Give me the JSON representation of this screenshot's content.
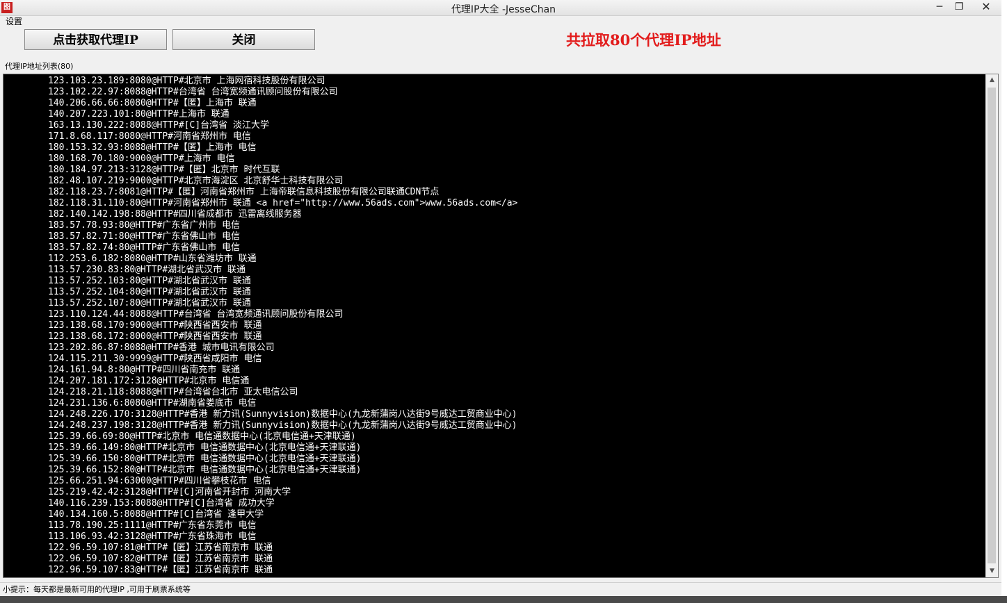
{
  "window": {
    "title": "代理IP大全 -JesseChan",
    "icon_text": "图",
    "min_glyph": "─",
    "max_glyph": "❐",
    "close_glyph": "✕"
  },
  "menu": {
    "settings_label": "设置"
  },
  "toolbar": {
    "fetch_label": "点击获取代理IP",
    "close_label": "关闭",
    "count_text": "共拉取80个代理IP地址",
    "accent_color": "#e21b1b"
  },
  "list_group_label": "代理IP地址列表(80)",
  "proxy_list": [
    "123.103.23.189:8080@HTTP#北京市 上海网宿科技股份有限公司",
    "123.102.22.97:8088@HTTP#台湾省 台湾宽频通讯顾问股份有限公司",
    "140.206.66.66:8080@HTTP#【匿】上海市 联通",
    "140.207.223.101:80@HTTP#上海市 联通",
    "163.13.130.222:8088@HTTP#[C]台湾省 淡江大学",
    "171.8.68.117:8080@HTTP#河南省郑州市 电信",
    "180.153.32.93:8088@HTTP#【匿】上海市 电信",
    "180.168.70.180:9000@HTTP#上海市 电信",
    "180.184.97.213:3128@HTTP#【匿】北京市 时代互联",
    "182.48.107.219:9000@HTTP#北京市海淀区 北京舒华士科技有限公司",
    "182.118.23.7:8081@HTTP#【匿】河南省郑州市 上海帝联信息科技股份有限公司联通CDN节点",
    "182.118.31.110:80@HTTP#河南省郑州市 联通 <a href=\"http://www.56ads.com\">www.56ads.com</a>",
    "182.140.142.198:88@HTTP#四川省成都市 迅雷离线服务器",
    "183.57.78.93:80@HTTP#广东省广州市 电信",
    "183.57.82.71:80@HTTP#广东省佛山市 电信",
    "183.57.82.74:80@HTTP#广东省佛山市 电信",
    "112.253.6.182:8080@HTTP#山东省潍坊市 联通",
    "113.57.230.83:80@HTTP#湖北省武汉市 联通",
    "113.57.252.103:80@HTTP#湖北省武汉市 联通",
    "113.57.252.104:80@HTTP#湖北省武汉市 联通",
    "113.57.252.107:80@HTTP#湖北省武汉市 联通",
    "123.110.124.44:8088@HTTP#台湾省 台湾宽频通讯顾问股份有限公司",
    "123.138.68.170:9000@HTTP#陕西省西安市 联通",
    "123.138.68.172:8000@HTTP#陕西省西安市 联通",
    "123.202.86.87:8088@HTTP#香港 城市电讯有限公司",
    "124.115.211.30:9999@HTTP#陕西省咸阳市 电信",
    "124.161.94.8:80@HTTP#四川省南充市 联通",
    "124.207.181.172:3128@HTTP#北京市 电信通",
    "124.218.21.118:8088@HTTP#台湾省台北市 亚太电信公司",
    "124.231.136.6:8080@HTTP#湖南省娄底市 电信",
    "124.248.226.170:3128@HTTP#香港 新力讯(Sunnyvision)数据中心(九龙新蒲岗八达街9号威达工贸商业中心)",
    "124.248.237.198:3128@HTTP#香港 新力讯(Sunnyvision)数据中心(九龙新蒲岗八达街9号威达工贸商业中心)",
    "125.39.66.69:80@HTTP#北京市 电信通数据中心(北京电信通+天津联通)",
    "125.39.66.149:80@HTTP#北京市 电信通数据中心(北京电信通+天津联通)",
    "125.39.66.150:80@HTTP#北京市 电信通数据中心(北京电信通+天津联通)",
    "125.39.66.152:80@HTTP#北京市 电信通数据中心(北京电信通+天津联通)",
    "125.66.251.94:63000@HTTP#四川省攀枝花市 电信",
    "125.219.42.42:3128@HTTP#[C]河南省开封市 河南大学",
    "140.116.239.153:8088@HTTP#[C]台湾省 成功大学",
    "140.134.160.5:8088@HTTP#[C]台湾省 逢甲大学",
    "113.78.190.25:1111@HTTP#广东省东莞市 电信",
    "113.106.93.42:3128@HTTP#广东省珠海市 电信",
    "122.96.59.107:81@HTTP#【匿】江苏省南京市 联通",
    "122.96.59.107:82@HTTP#【匿】江苏省南京市 联通",
    "122.96.59.107:83@HTTP#【匿】江苏省南京市 联通"
  ],
  "scrollbar": {
    "up_glyph": "▲",
    "down_glyph": "▼"
  },
  "status_text": "小提示：每天都是最新可用的代理IP ,可用于刷票系统等"
}
